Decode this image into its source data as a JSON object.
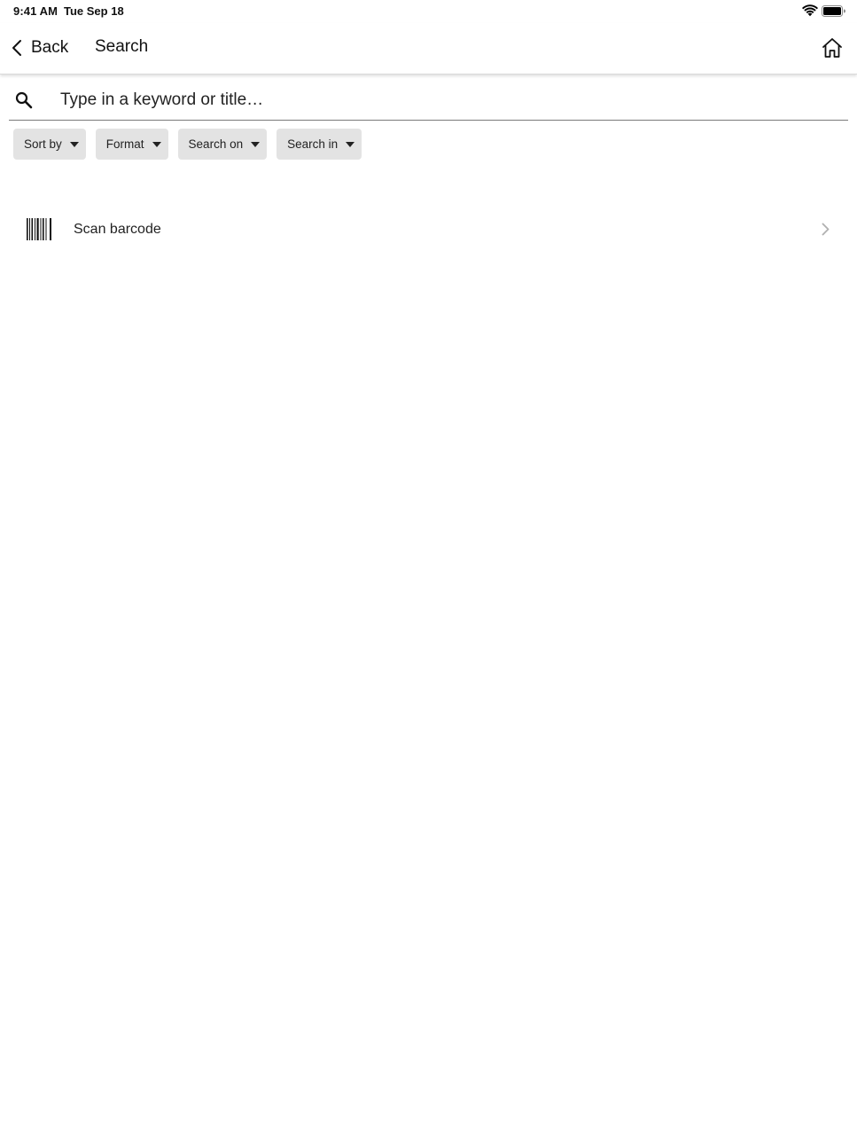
{
  "status_bar": {
    "time": "9:41 AM",
    "date": "Tue Sep 18",
    "wifi_icon": "wifi-icon",
    "battery_icon": "battery-icon"
  },
  "nav": {
    "back_label": "Back",
    "back_icon": "chevron-left-icon",
    "title": "Search",
    "home_icon": "home-icon"
  },
  "search": {
    "icon": "search-icon",
    "placeholder": "Type in a keyword or title…",
    "value": ""
  },
  "filters": [
    {
      "label": "Sort by",
      "icon": "caret-down-icon"
    },
    {
      "label": "Format",
      "icon": "caret-down-icon"
    },
    {
      "label": "Search on",
      "icon": "caret-down-icon"
    },
    {
      "label": "Search in",
      "icon": "caret-down-icon"
    }
  ],
  "scan": {
    "icon": "barcode-icon",
    "label": "Scan barcode",
    "chevron_icon": "chevron-right-icon"
  },
  "colors": {
    "chip_background": "#e3e3e3",
    "text": "#111111",
    "divider": "#7a7a7a",
    "chevron": "#b0b0b0"
  }
}
